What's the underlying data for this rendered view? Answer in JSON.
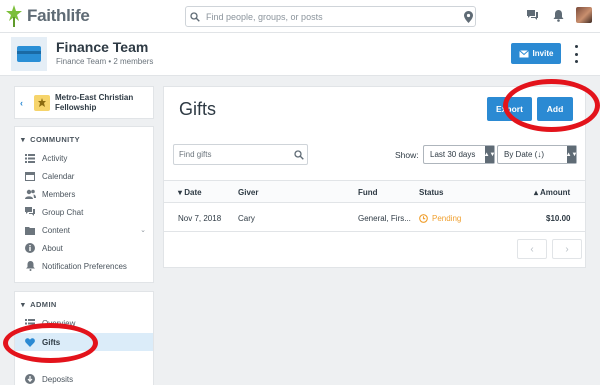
{
  "topbar": {
    "logo_text": "Faithlife",
    "search_placeholder": "Find people, groups, or posts",
    "icons": [
      "logo-icon",
      "search-icon",
      "location-pin-icon",
      "chat-icon",
      "bell-icon",
      "avatar"
    ]
  },
  "group": {
    "title": "Finance Team",
    "subtitle": "Finance Team • 2 members",
    "invite_label": "Invite"
  },
  "sidebar": {
    "parent_group": "Metro-East Christian Fellowship",
    "community_title": "COMMUNITY",
    "community_items": [
      {
        "label": "Activity",
        "icon": "activity-icon"
      },
      {
        "label": "Calendar",
        "icon": "calendar-icon"
      },
      {
        "label": "Members",
        "icon": "members-icon"
      },
      {
        "label": "Group Chat",
        "icon": "chat-icon"
      },
      {
        "label": "Content",
        "icon": "folder-icon"
      },
      {
        "label": "About",
        "icon": "info-icon"
      },
      {
        "label": "Notification Preferences",
        "icon": "bell-icon"
      }
    ],
    "admin_title": "ADMIN",
    "admin_items": [
      {
        "label": "Overview",
        "icon": "overview-icon"
      },
      {
        "label": "Gifts",
        "icon": "heart-icon",
        "active": true
      },
      {
        "label": "Deposits",
        "icon": "deposit-icon"
      }
    ]
  },
  "main": {
    "title": "Gifts",
    "export_label": "Export",
    "add_label": "Add",
    "find_placeholder": "Find gifts",
    "show_label": "Show:",
    "range_value": "Last 30 days",
    "sort_value": "By Date (↓)",
    "columns": {
      "date": "Date",
      "giver": "Giver",
      "fund": "Fund",
      "status": "Status",
      "amount": "Amount"
    },
    "rows": [
      {
        "date": "Nov 7, 2018",
        "giver": "Cary",
        "fund": "General, Firs...",
        "status": "Pending",
        "amount": "$10.00"
      }
    ],
    "pager_prev": "‹",
    "pager_next": "›"
  },
  "colors": {
    "accent": "#2b8ad3",
    "pending": "#f0a030",
    "annotation": "#e3131b"
  }
}
